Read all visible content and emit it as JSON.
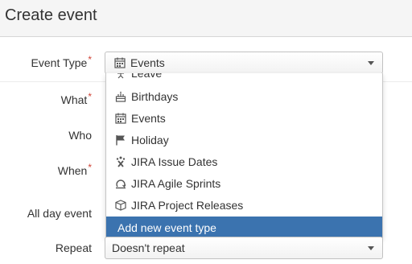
{
  "dialog": {
    "title": "Create event"
  },
  "form": {
    "event_type_label": "Event Type",
    "what_label": "What",
    "who_label": "Who",
    "when_label": "When",
    "all_day_label": "All day event",
    "repeat_label": "Repeat",
    "required_marker": "*",
    "event_type_value": "Events",
    "event_type_icon": "calendar-icon",
    "repeat_value": "Doesn't repeat"
  },
  "dropdown": {
    "options": [
      {
        "label": "Leave",
        "icon": "leave-icon"
      },
      {
        "label": "Birthdays",
        "icon": "cake-icon"
      },
      {
        "label": "Events",
        "icon": "calendar-icon"
      },
      {
        "label": "Holiday",
        "icon": "flag-icon"
      },
      {
        "label": "JIRA Issue Dates",
        "icon": "jira-issue-icon"
      },
      {
        "label": "JIRA Agile Sprints",
        "icon": "sprint-icon"
      },
      {
        "label": "JIRA Project Releases",
        "icon": "release-box-icon"
      }
    ],
    "add_label": "Add new event type"
  },
  "colors": {
    "highlight": "#3b73af",
    "required": "#d04437",
    "header_bg": "#f5f5f5"
  }
}
